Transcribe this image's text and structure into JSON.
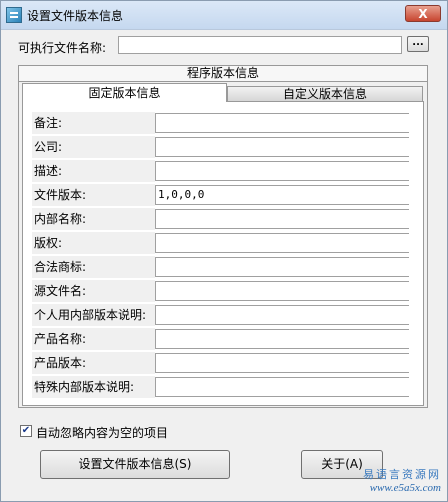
{
  "window": {
    "title": "设置文件版本信息",
    "close_label": "X"
  },
  "exe": {
    "label": "可执行文件名称:",
    "value": "",
    "browse_label": "..."
  },
  "outer_tab": {
    "label": "程序版本信息"
  },
  "subtabs": [
    {
      "label": "固定版本信息",
      "active": true
    },
    {
      "label": "自定义版本信息",
      "active": false
    }
  ],
  "fields": [
    {
      "label": "备注:",
      "value": ""
    },
    {
      "label": "公司:",
      "value": ""
    },
    {
      "label": "描述:",
      "value": ""
    },
    {
      "label": "文件版本:",
      "value": "1,0,0,0"
    },
    {
      "label": "内部名称:",
      "value": ""
    },
    {
      "label": "版权:",
      "value": ""
    },
    {
      "label": "合法商标:",
      "value": ""
    },
    {
      "label": "源文件名:",
      "value": ""
    },
    {
      "label": "个人用内部版本说明:",
      "value": ""
    },
    {
      "label": "产品名称:",
      "value": ""
    },
    {
      "label": "产品版本:",
      "value": ""
    },
    {
      "label": "特殊内部版本说明:",
      "value": ""
    }
  ],
  "auto_ignore": {
    "checked": true,
    "label": "自动忽略内容为空的项目"
  },
  "buttons": {
    "set_label": "设置文件版本信息(S)",
    "about_label": "关于(A)"
  },
  "watermark": {
    "line1": "易语言资源网",
    "line2": "www.e5a5x.com"
  }
}
